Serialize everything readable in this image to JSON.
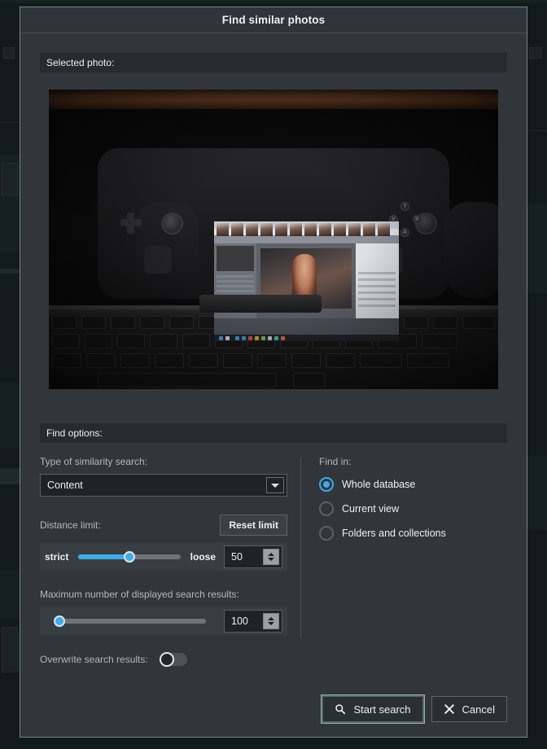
{
  "window": {
    "title": "Find similar photos"
  },
  "sections": {
    "selected_photo_header": "Selected photo:",
    "find_options_header": "Find options:"
  },
  "photo": {
    "description": "Steam Deck handheld console displaying photo management software, sitting on a keyboard in a dim room with a wooden shelf above"
  },
  "options": {
    "similarity_type_label": "Type of similarity search:",
    "similarity_type_value": "Content",
    "similarity_type_options": [
      "Content"
    ],
    "distance_limit_label": "Distance limit:",
    "reset_limit_label": "Reset limit",
    "strict_label": "strict",
    "loose_label": "loose",
    "distance_value": "50",
    "distance_percent": 50,
    "max_results_label": "Maximum number of displayed search results:",
    "max_results_value": "100",
    "max_results_percent": 2,
    "overwrite_label": "Overwrite search results:",
    "overwrite_on": false
  },
  "find_in": {
    "label": "Find in:",
    "options": [
      {
        "label": "Whole database",
        "selected": true
      },
      {
        "label": "Current view",
        "selected": false
      },
      {
        "label": "Folders and collections",
        "selected": false
      }
    ]
  },
  "footer": {
    "start_search_label": "Start search",
    "cancel_label": "Cancel"
  },
  "colors": {
    "accent": "#3daee9",
    "dialog_bg": "#31363b",
    "header_bg": "#262b30",
    "border": "#6e8a84"
  }
}
